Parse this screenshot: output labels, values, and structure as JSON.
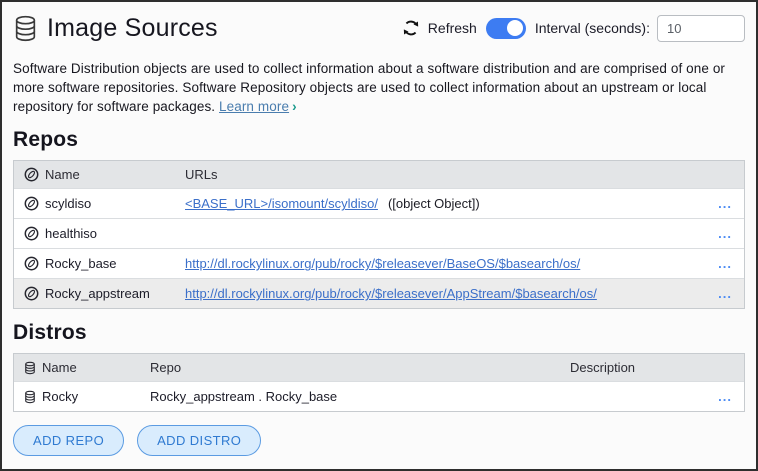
{
  "header": {
    "title": "Image Sources",
    "refresh_label": "Refresh",
    "toggle_state": "on",
    "interval_label": "Interval (seconds):",
    "interval_value": "10"
  },
  "description": {
    "text": "Software Distribution objects are used to collect information about a software distribution and are comprised of one or more software repositories. Software Repository objects are used to collect information about an upstream or local repository for software packages.",
    "link_label": "Learn more",
    "link_arrow": "›"
  },
  "repos": {
    "heading": "Repos",
    "columns": {
      "name": "Name",
      "urls": "URLs"
    },
    "rows": [
      {
        "name": "scyldiso",
        "url": "<BASE_URL>/isomount/scyldiso/",
        "url_suffix": "([object Object])",
        "shaded": false
      },
      {
        "name": "healthiso",
        "url": "",
        "url_suffix": "",
        "shaded": false
      },
      {
        "name": "Rocky_base",
        "url": "http://dl.rockylinux.org/pub/rocky/$releasever/BaseOS/$basearch/os/",
        "url_suffix": "",
        "shaded": false
      },
      {
        "name": "Rocky_appstream",
        "url": "http://dl.rockylinux.org/pub/rocky/$releasever/AppStream/$basearch/os/",
        "url_suffix": "",
        "shaded": true
      }
    ]
  },
  "distros": {
    "heading": "Distros",
    "columns": {
      "name": "Name",
      "repo": "Repo",
      "description": "Description"
    },
    "rows": [
      {
        "name": "Rocky",
        "repo": "Rocky_appstream . Rocky_base",
        "description": "",
        "shaded": false
      }
    ]
  },
  "row_menu_label": "...",
  "buttons": {
    "add_repo": "ADD REPO",
    "add_distro": "ADD DISTRO"
  },
  "colors": {
    "toggle_on": "#3d7cf2",
    "link_blue": "#3b6fc9",
    "learn_more_link": "#4a7dae",
    "learn_more_arrow": "#1a9a8c",
    "row_menu_blue": "#4b8bf4",
    "button_bg": "#d9ecfd",
    "button_border": "#5b9be2",
    "button_text": "#2f7ad1",
    "table_header_bg": "#e3e5e7"
  }
}
